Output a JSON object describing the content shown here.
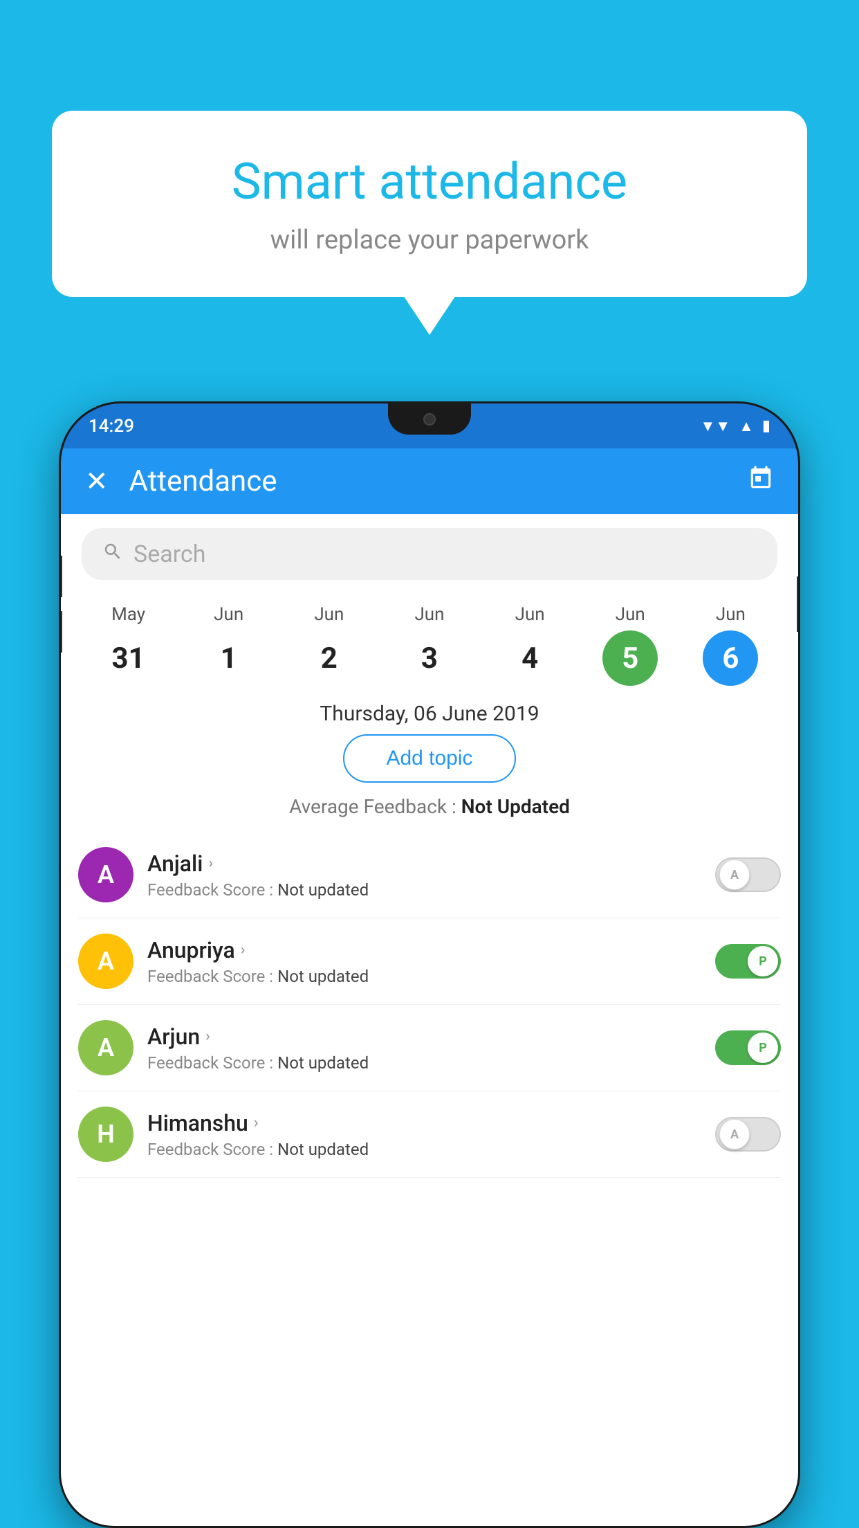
{
  "background_color": "#1BB8E8",
  "speech_bubble": {
    "title": "Smart attendance",
    "subtitle": "will replace your paperwork"
  },
  "phone": {
    "status_bar": {
      "time": "14:29",
      "wifi_icon": "▲",
      "signal_icon": "▲",
      "battery_icon": "▮"
    },
    "app_bar": {
      "close_label": "✕",
      "title": "Attendance",
      "calendar_icon": "📅"
    },
    "search": {
      "placeholder": "Search"
    },
    "dates": [
      {
        "month": "May",
        "day": "31",
        "state": "normal"
      },
      {
        "month": "Jun",
        "day": "1",
        "state": "normal"
      },
      {
        "month": "Jun",
        "day": "2",
        "state": "normal"
      },
      {
        "month": "Jun",
        "day": "3",
        "state": "normal"
      },
      {
        "month": "Jun",
        "day": "4",
        "state": "normal"
      },
      {
        "month": "Jun",
        "day": "5",
        "state": "today"
      },
      {
        "month": "Jun",
        "day": "6",
        "state": "selected"
      }
    ],
    "selected_date": "Thursday, 06 June 2019",
    "add_topic_label": "Add topic",
    "avg_feedback_label": "Average Feedback : ",
    "avg_feedback_value": "Not Updated",
    "students": [
      {
        "name": "Anjali",
        "avatar_letter": "A",
        "avatar_color": "#9C27B0",
        "feedback_label": "Feedback Score : ",
        "feedback_value": "Not updated",
        "toggle_state": "off",
        "toggle_letter": "A"
      },
      {
        "name": "Anupriya",
        "avatar_letter": "A",
        "avatar_color": "#FFC107",
        "feedback_label": "Feedback Score : ",
        "feedback_value": "Not updated",
        "toggle_state": "on",
        "toggle_letter": "P"
      },
      {
        "name": "Arjun",
        "avatar_letter": "A",
        "avatar_color": "#8BC34A",
        "feedback_label": "Feedback Score : ",
        "feedback_value": "Not updated",
        "toggle_state": "on",
        "toggle_letter": "P"
      },
      {
        "name": "Himanshu",
        "avatar_letter": "H",
        "avatar_color": "#8BC34A",
        "feedback_label": "Feedback Score : ",
        "feedback_value": "Not updated",
        "toggle_state": "off",
        "toggle_letter": "A"
      }
    ]
  }
}
